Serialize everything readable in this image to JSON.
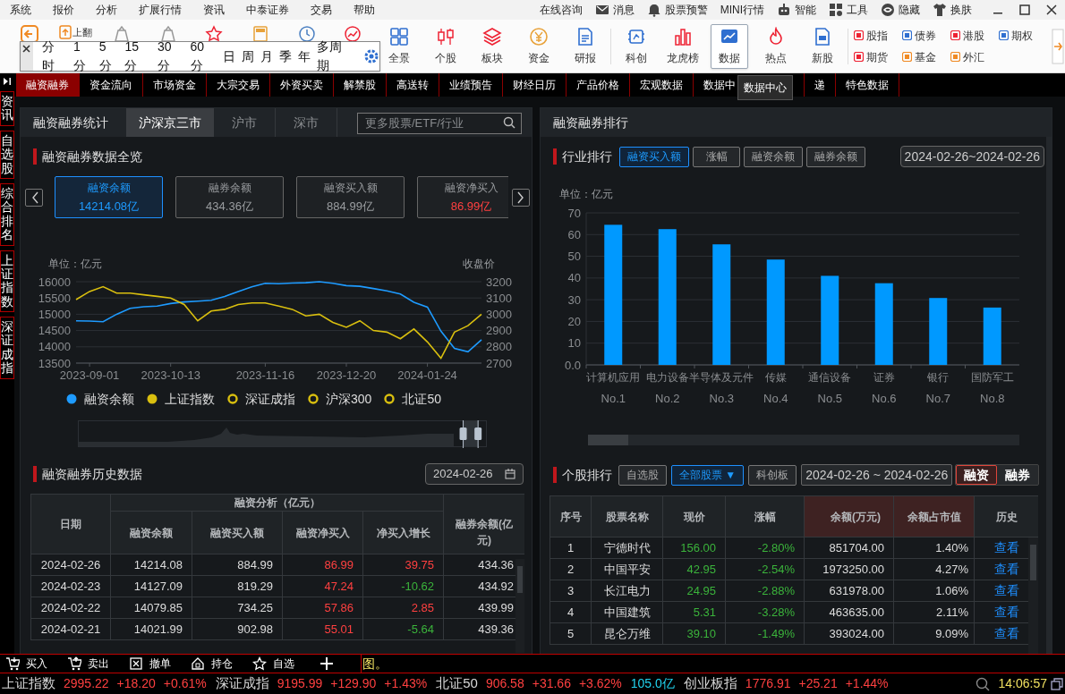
{
  "menu_bar": {
    "items": [
      "系统",
      "报价",
      "分析",
      "扩展行情",
      "资讯",
      "中泰证券",
      "交易",
      "帮助"
    ],
    "right_items": [
      "在线咨询",
      "消息",
      "股票预警",
      "MINI行情",
      "智能",
      "工具",
      "隐藏",
      "换肤"
    ]
  },
  "toolbar": {
    "page_up_label": "上翻",
    "buttons": [
      {
        "label": "全景",
        "selected": false
      },
      {
        "label": "个股",
        "selected": false
      },
      {
        "label": "板块",
        "selected": false
      },
      {
        "label": "资金",
        "selected": false
      },
      {
        "label": "研报",
        "selected": false
      },
      {
        "label": "科创",
        "selected": false
      },
      {
        "label": "龙虎榜",
        "selected": false
      },
      {
        "label": "数据",
        "selected": true
      },
      {
        "label": "热点",
        "selected": false
      },
      {
        "label": "新股",
        "selected": false
      }
    ],
    "quick_links": [
      "股指",
      "债券",
      "港股",
      "期权",
      "期货",
      "基金",
      "外汇"
    ]
  },
  "period_popup": {
    "periods": [
      "分时",
      "1分",
      "5分",
      "15分",
      "30分",
      "60分",
      "日",
      "周",
      "月",
      "季",
      "年",
      "多周期"
    ]
  },
  "nav_tabs": [
    {
      "label": "融资融券",
      "selected": true,
      "hovered": false
    },
    {
      "label": "资金流向",
      "selected": false,
      "hovered": false
    },
    {
      "label": "市场资金",
      "selected": false,
      "hovered": false
    },
    {
      "label": "大宗交易",
      "selected": false,
      "hovered": false
    },
    {
      "label": "外资买卖",
      "selected": false,
      "hovered": false
    },
    {
      "label": "解禁股",
      "selected": false,
      "hovered": false
    },
    {
      "label": "高送转",
      "selected": false,
      "hovered": false
    },
    {
      "label": "业绩预告",
      "selected": false,
      "hovered": false
    },
    {
      "label": "财经日历",
      "selected": false,
      "hovered": false
    },
    {
      "label": "产品价格",
      "selected": false,
      "hovered": false
    },
    {
      "label": "宏观数据",
      "selected": false,
      "hovered": false
    },
    {
      "label": "数据中",
      "selected": false,
      "hovered": true
    },
    {
      "label": "递",
      "selected": false,
      "hovered": false
    },
    {
      "label": "特色数据",
      "selected": false,
      "hovered": false
    }
  ],
  "tooltip": "数据中心",
  "side_tabs": [
    "资讯",
    "自选股",
    "综合排名",
    "上证指数",
    "深证成指"
  ],
  "left_panel": {
    "title": "融资融券统计",
    "tabs": [
      {
        "label": "沪深京三市",
        "selected": true
      },
      {
        "label": "沪市",
        "selected": false
      },
      {
        "label": "深市",
        "selected": false
      }
    ],
    "search": {
      "placeholder": "更多股票/ETF/行业"
    },
    "overview": {
      "title": "融资融券数据全览",
      "cards": [
        {
          "label": "融资余额",
          "value": "14214.08亿",
          "selected": true,
          "rising": false
        },
        {
          "label": "融券余额",
          "value": "434.36亿",
          "selected": false,
          "rising": false
        },
        {
          "label": "融资买入额",
          "value": "884.99亿",
          "selected": false,
          "rising": false
        },
        {
          "label": "融资净买入",
          "value": "86.99亿",
          "selected": false,
          "rising": true
        }
      ]
    },
    "chart": {
      "chart_data": {
        "type": "line",
        "grid": true,
        "ylabel": "单位：亿元",
        "y2label": "收盘价",
        "ylim": [
          13500,
          16000
        ],
        "yticks": [
          13500,
          14000,
          14500,
          15000,
          15500,
          16000
        ],
        "y2lim": [
          2700,
          3200
        ],
        "y2ticks": [
          2700,
          2800,
          2900,
          3000,
          3100,
          3200
        ],
        "categories": [
          null,
          "2023-09-01",
          null,
          null,
          null,
          null,
          null,
          "2023-10-13",
          null,
          null,
          null,
          null,
          null,
          null,
          "2023-11-16",
          null,
          null,
          null,
          null,
          null,
          "2023-12-20",
          null,
          null,
          null,
          null,
          null,
          "2024-01-24",
          null,
          null,
          null,
          null
        ],
        "series": [
          {
            "color": "#1e9bff",
            "values": [
              14800,
              14790,
              14770,
              15000,
              15180,
              15230,
              15250,
              15330,
              15380,
              15400,
              15430,
              15550,
              15700,
              15840,
              15950,
              15940,
              15960,
              15970,
              16000,
              15950,
              15880,
              15860,
              15790,
              15720,
              15620,
              15370,
              15220,
              14480,
              13950,
              13850,
              14220
            ]
          },
          {
            "color": "#d9bf0f",
            "axis": "y2",
            "values": [
              3090,
              3140,
              3170,
              3130,
              3130,
              3120,
              3110,
              3100,
              3060,
              2960,
              3020,
              3030,
              3060,
              3070,
              3070,
              3050,
              3030,
              2990,
              3000,
              2950,
              2920,
              2960,
              2900,
              2890,
              2850,
              2910,
              2830,
              2730,
              2890,
              2930,
              3000
            ]
          }
        ]
      },
      "legend": [
        {
          "label": "融资余额",
          "color": "#1e9bff",
          "on": true
        },
        {
          "label": "上证指数",
          "color": "#d9bf0f",
          "on": true
        },
        {
          "label": "深证成指",
          "color": "#d9bf0f",
          "on": false
        },
        {
          "label": "沪深300",
          "color": "#d9bf0f",
          "on": false
        },
        {
          "label": "北证50",
          "color": "#d9bf0f",
          "on": false
        }
      ],
      "zoom_handles": [
        {
          "level": 0.95
        },
        {
          "level": 0.987
        }
      ]
    },
    "history": {
      "title": "融资融券历史数据",
      "date": "2024-02-26",
      "date_column": "日期",
      "group_header": "融资分析（亿元）",
      "columns": [
        "融资余额",
        "融资买入额",
        "融资净买入",
        "净买入增长"
      ],
      "last_column": "融券余额(亿元)",
      "rows": [
        {
          "date": "2024-02-26",
          "balance": "14214.08",
          "buy": "884.99",
          "net_buy": "86.99",
          "net_rising": true,
          "growth": "39.75",
          "growth_rising": true,
          "short_balance": "434.36"
        },
        {
          "date": "2024-02-23",
          "balance": "14127.09",
          "buy": "819.29",
          "net_buy": "47.24",
          "net_rising": true,
          "growth": "-10.62",
          "growth_rising": false,
          "short_balance": "434.92"
        },
        {
          "date": "2024-02-22",
          "balance": "14079.85",
          "buy": "734.25",
          "net_buy": "57.86",
          "net_rising": true,
          "growth": "2.85",
          "growth_rising": true,
          "short_balance": "439.99"
        },
        {
          "date": "2024-02-21",
          "balance": "14021.99",
          "buy": "902.98",
          "net_buy": "55.01",
          "net_rising": true,
          "growth": "-5.64",
          "growth_rising": false,
          "short_balance": "439.36"
        }
      ]
    }
  },
  "right_panel": {
    "title": "融资融券排行",
    "industry": {
      "title": "行业排行",
      "metrics": [
        {
          "label": "融资买入额",
          "selected": true
        },
        {
          "label": "涨幅",
          "selected": false
        },
        {
          "label": "融资余额",
          "selected": false
        },
        {
          "label": "融券余额",
          "selected": false
        }
      ],
      "date_range": "2024-02-26~2024-02-26",
      "rank_labels": [
        "No.1",
        "No.2",
        "No.3",
        "No.4",
        "No.5",
        "No.6",
        "No.7",
        "No.8"
      ],
      "chart_data": {
        "type": "bar",
        "grid": true,
        "ylabel": "单位：亿元",
        "categories": [
          "计算机应用",
          "电力设备",
          "半导体及元件",
          "传媒",
          "通信设备",
          "证券",
          "银行",
          "国防军工"
        ],
        "ylim": [
          0,
          70
        ],
        "yticks": [
          {
            "value": 0,
            "label": "0.0"
          },
          10,
          20,
          30,
          40,
          50,
          60,
          70
        ],
        "series": [
          {
            "color": "#0099ff",
            "values": [
              64.5,
              62.5,
              55.5,
              48.5,
              41,
              37.6,
              30.8,
              26.4
            ]
          }
        ]
      }
    },
    "stocks": {
      "title": "个股排行",
      "filters": [
        {
          "label": "自选股",
          "selected": false
        },
        {
          "label": "全部股票 ▼",
          "selected": true
        },
        {
          "label": "科创板",
          "selected": false
        }
      ],
      "date_range": "2024-02-26 ~ 2024-02-26",
      "modes": [
        {
          "label": "融资",
          "selected": true
        },
        {
          "label": "融券",
          "selected": false
        }
      ],
      "columns": [
        {
          "label": "序号",
          "highlighted": false
        },
        {
          "label": "股票名称",
          "highlighted": false
        },
        {
          "label": "现价",
          "highlighted": false
        },
        {
          "label": "涨幅",
          "highlighted": false
        },
        {
          "label": "余额(万元)",
          "highlighted": true
        },
        {
          "label": "余额占市值",
          "highlighted": true
        },
        {
          "label": "历史",
          "highlighted": false
        }
      ],
      "rows": [
        {
          "rank": "1",
          "name": "宁德时代",
          "price": "156.00",
          "change": "-2.80%",
          "balance": "851704.00",
          "ratio": "1.40%",
          "history": "查看",
          "rising": false
        },
        {
          "rank": "2",
          "name": "中国平安",
          "price": "42.95",
          "change": "-2.54%",
          "balance": "1973250.00",
          "ratio": "4.27%",
          "history": "查看",
          "rising": false
        },
        {
          "rank": "3",
          "name": "长江电力",
          "price": "24.95",
          "change": "-2.88%",
          "balance": "631978.00",
          "ratio": "1.06%",
          "history": "查看",
          "rising": false
        },
        {
          "rank": "4",
          "name": "中国建筑",
          "price": "5.31",
          "change": "-3.28%",
          "balance": "463635.00",
          "ratio": "2.11%",
          "history": "查看",
          "rising": false
        },
        {
          "rank": "5",
          "name": "昆仑万维",
          "price": "39.10",
          "change": "-1.49%",
          "balance": "393024.00",
          "ratio": "9.09%",
          "history": "查看",
          "rising": false
        }
      ]
    }
  },
  "trade_bar": {
    "buttons": [
      "买入",
      "卖出",
      "撤单",
      "持仓",
      "自选"
    ],
    "message": "图。"
  },
  "ticker": {
    "items": [
      {
        "name": "上证指数",
        "price": "2995.22",
        "change": "+18.20",
        "pct": "+0.61%",
        "rising": true
      },
      {
        "name": "深证成指",
        "price": "9195.99",
        "change": "+129.90",
        "pct": "+1.43%",
        "rising": true
      },
      {
        "name": "北证50",
        "price": "906.58",
        "change": "+31.66",
        "pct": "+3.62%",
        "rising": true,
        "amount": "105.0亿"
      },
      {
        "name": "创业板指",
        "price": "1776.91",
        "change": "+25.21",
        "pct": "+1.44%",
        "rising": true
      }
    ],
    "time": "14:06:57"
  }
}
